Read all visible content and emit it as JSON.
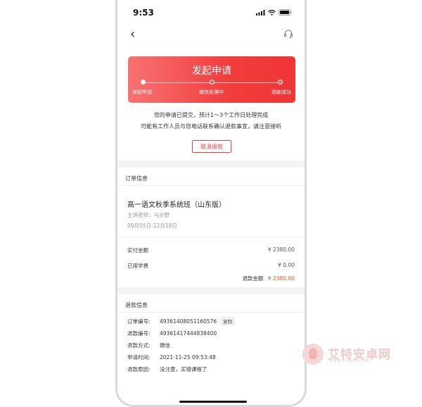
{
  "status_bar": {
    "time": "9:53"
  },
  "banner": {
    "title": "发起申请",
    "steps": [
      "发起申请",
      "微信处理中",
      "退款成功"
    ]
  },
  "notice": {
    "line1": "您的申请已提交，预计1～3个工作日处理完成",
    "line2": "可能有工作人员与您电话联系确认退款事宜，请注意接听"
  },
  "cancel_label": "取消退款",
  "order_info": {
    "header": "订单信息",
    "course_title": "高一语文秋季系统班（山东版）",
    "teacher": "主讲老师：马步野",
    "dates": "09月05日-12月18日",
    "paid_label": "实付金额",
    "paid_value": "¥ 2380.00",
    "used_label": "已用学费",
    "used_value": "¥ 0.00",
    "refund_label": "退款金额",
    "refund_value": "¥ 2380.00"
  },
  "refund_info": {
    "header": "退款信息",
    "order_no_label": "订单编号:",
    "order_no": "49361408051160576",
    "copy_label": "复制",
    "refund_no_label": "退款编号:",
    "refund_no": "49361417444838400",
    "method_label": "退款方式:",
    "method": "微信",
    "time_label": "申请时间:",
    "time": "2021-11-25 09:53:48",
    "reason_label": "退款原因:",
    "reason": "没注意，买错课程了"
  },
  "watermark": {
    "text": "艾特安卓网",
    "sub": "WWW.ITMOP.COM"
  },
  "colors": {
    "accent": "#f23d3d",
    "amount": "#ee5a24"
  }
}
